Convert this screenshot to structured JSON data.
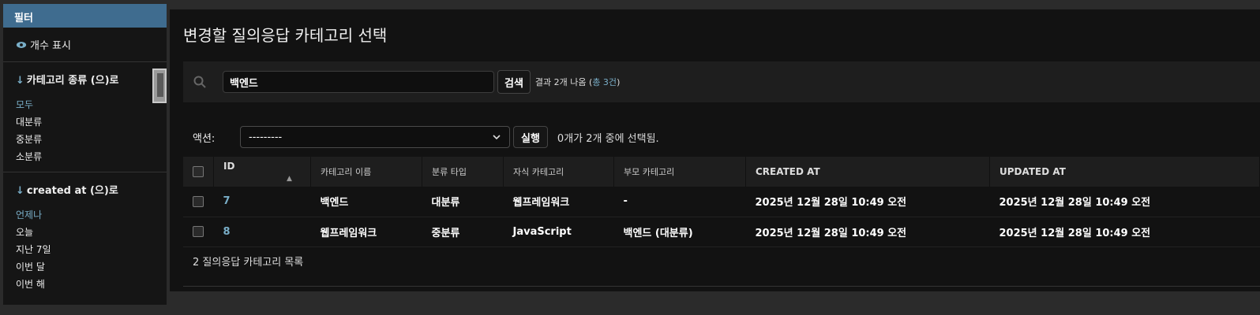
{
  "sidebar": {
    "header": "필터",
    "show_count": "개수 표시",
    "groups": [
      {
        "title": "카테고리 종류 (으)로",
        "items": [
          {
            "label": "모두",
            "selected": true
          },
          {
            "label": "대분류",
            "selected": false
          },
          {
            "label": "중분류",
            "selected": false
          },
          {
            "label": "소분류",
            "selected": false
          }
        ]
      },
      {
        "title": "created at (으)로",
        "items": [
          {
            "label": "언제나",
            "selected": true
          },
          {
            "label": "오늘",
            "selected": false
          },
          {
            "label": "지난 7일",
            "selected": false
          },
          {
            "label": "이번 달",
            "selected": false
          },
          {
            "label": "이번 해",
            "selected": false
          }
        ]
      }
    ]
  },
  "main": {
    "title": "변경할 질의응답 카테고리 선택",
    "search": {
      "value": "백엔드",
      "button": "검색",
      "result_prefix": "결과 2개 나옴 (",
      "result_total": "총 3건",
      "result_suffix": ")"
    },
    "actions": {
      "label": "액션:",
      "selected": "---------",
      "run": "실행",
      "selection_count": "0개가 2개 중에 선택됨."
    },
    "table": {
      "columns": [
        "ID",
        "카테고리 이름",
        "분류 타입",
        "자식 카테고리",
        "부모 카테고리",
        "CREATED AT",
        "UPDATED AT"
      ],
      "rows": [
        {
          "id": "7",
          "name": "백엔드",
          "type": "대분류",
          "child": "웹프레임워크",
          "parent": "-",
          "created": "2025년 12월 28일 10:49 오전",
          "updated": "2025년 12월 28일 10:49 오전"
        },
        {
          "id": "8",
          "name": "웹프레임워크",
          "type": "중분류",
          "child": "JavaScript",
          "parent": "백엔드 (대분류)",
          "created": "2025년 12월 28일 10:49 오전",
          "updated": "2025년 12월 28일 10:49 오전"
        }
      ]
    },
    "footer": "2 질의응답 카테고리 목록"
  },
  "colors": {
    "accent": "#79aec8",
    "header_bar": "#3f6c8f"
  }
}
